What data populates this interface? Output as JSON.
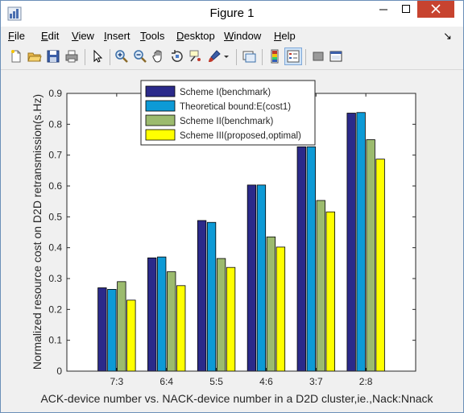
{
  "window": {
    "title": "Figure 1",
    "controls": {
      "minimize": "minimize",
      "maximize": "maximize",
      "close": "close"
    }
  },
  "menubar": {
    "items": [
      {
        "label": "File",
        "ul": "F",
        "rest": "ile"
      },
      {
        "label": "Edit",
        "ul": "E",
        "rest": "dit"
      },
      {
        "label": "View",
        "ul": "V",
        "rest": "iew"
      },
      {
        "label": "Insert",
        "ul": "I",
        "rest": "nsert"
      },
      {
        "label": "Tools",
        "ul": "T",
        "rest": "ools"
      },
      {
        "label": "Desktop",
        "ul": "D",
        "rest": "esktop"
      },
      {
        "label": "Window",
        "ul": "W",
        "rest": "indow"
      },
      {
        "label": "Help",
        "ul": "H",
        "rest": "elp"
      }
    ],
    "close_glyph": "↘"
  },
  "toolbar": {
    "icons": [
      "new-figure-icon",
      "open-file-icon",
      "save-icon",
      "print-icon",
      "pointer-icon",
      "zoom-in-icon",
      "zoom-out-icon",
      "pan-icon",
      "rotate-icon",
      "data-cursor-icon",
      "brush-icon",
      "link-icon",
      "colorbar-icon",
      "legend-icon",
      "hide-tools-icon",
      "show-tools-icon"
    ]
  },
  "chart_data": {
    "type": "bar",
    "categories": [
      "7:3",
      "6:4",
      "5:5",
      "4:6",
      "3:7",
      "2:8"
    ],
    "series": [
      {
        "name": "Scheme I(benchmark)",
        "color": "#2b2a8a",
        "values": [
          0.27,
          0.367,
          0.488,
          0.603,
          0.727,
          0.836
        ]
      },
      {
        "name": "Theoretical bound:E(cost1)",
        "color": "#0d9ad6",
        "values": [
          0.265,
          0.37,
          0.482,
          0.603,
          0.727,
          0.838
        ]
      },
      {
        "name": "Scheme II(benchmark)",
        "color": "#9cbb6e",
        "values": [
          0.29,
          0.322,
          0.365,
          0.435,
          0.553,
          0.75
        ]
      },
      {
        "name": "Scheme III(proposed,optimal)",
        "color": "#ffff00",
        "values": [
          0.23,
          0.277,
          0.336,
          0.402,
          0.516,
          0.687
        ]
      }
    ],
    "title": "",
    "xlabel": "ACK-device number vs. NACK-device number in a D2D cluster,ie.,Nack:Nnack",
    "ylabel": "Normalized resource cost on D2D retransmission(s.Hz)",
    "ylim": [
      0,
      0.9
    ],
    "yticks": [
      "0",
      "0.1",
      "0.2",
      "0.3",
      "0.4",
      "0.5",
      "0.6",
      "0.7",
      "0.8",
      "0.9"
    ],
    "grid": false,
    "legend_position": "top-center"
  }
}
